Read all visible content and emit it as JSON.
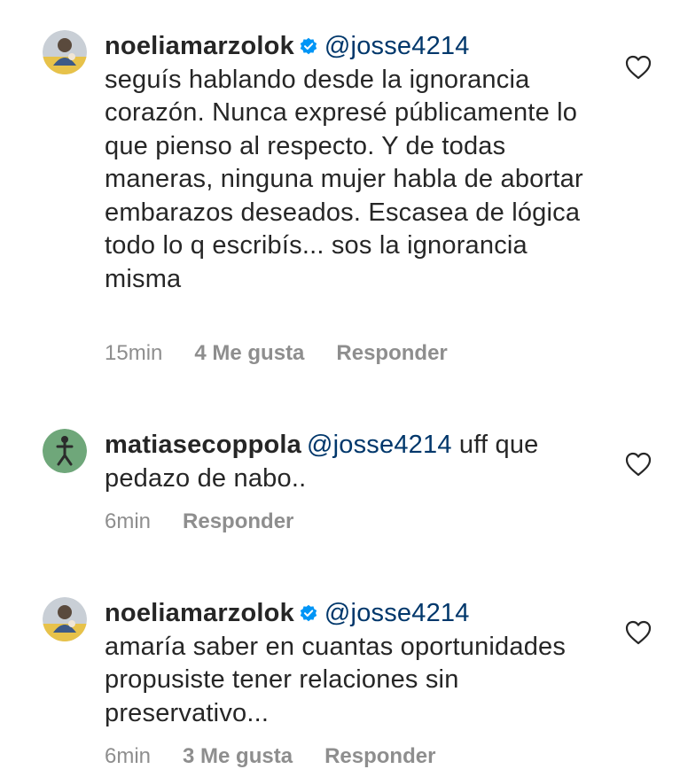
{
  "comments": [
    {
      "username": "noeliamarzolok",
      "verified": true,
      "mention": "@josse4214",
      "text": "seguís hablando desde la ignorancia corazón. Nunca expresé públicamente lo que pienso al respecto. Y de todas maneras, ninguna mujer habla de abortar embarazos deseados. Escasea de lógica todo lo q escribís... sos la ignorancia misma",
      "time": "15min",
      "likes": "4 Me gusta",
      "reply": "Responder"
    },
    {
      "username": "matiasecoppola",
      "verified": false,
      "mention": "@josse4214",
      "text": "uff que pedazo de nabo..",
      "time": "6min",
      "reply": "Responder"
    },
    {
      "username": "noeliamarzolok",
      "verified": true,
      "mention": "@josse4214",
      "text": "amaría saber en cuantas oportunidades propusiste tener relaciones sin preservativo...",
      "time": "6min",
      "likes": "3 Me gusta",
      "reply": "Responder"
    }
  ],
  "icons": {
    "verified": "verified-badge-icon",
    "like": "heart-outline-icon"
  },
  "colors": {
    "text": "#262626",
    "meta": "#8e8e8e",
    "mention": "#00376b",
    "verified": "#0095f6"
  }
}
